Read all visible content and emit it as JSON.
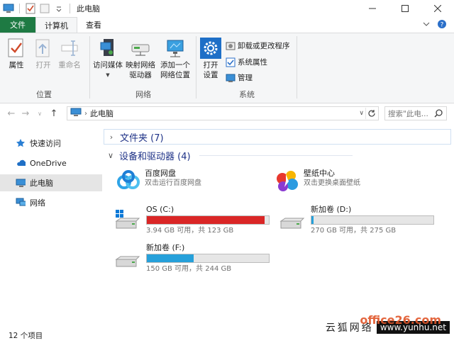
{
  "window": {
    "title": "此电脑",
    "controls": [
      "minimize",
      "maximize",
      "close"
    ]
  },
  "ribbon": {
    "tabs": [
      {
        "label": "文件",
        "active": false
      },
      {
        "label": "计算机",
        "active": true
      },
      {
        "label": "查看",
        "active": false
      }
    ],
    "groups": {
      "location": {
        "label": "位置",
        "buttons": [
          {
            "label": "属性",
            "icon": "properties-icon",
            "enabled": true
          },
          {
            "label": "打开",
            "icon": "open-icon",
            "enabled": false
          },
          {
            "label": "重命名",
            "icon": "rename-icon",
            "enabled": false
          }
        ]
      },
      "network": {
        "label": "网络",
        "access_media": {
          "label": "访问媒体",
          "icon": "media-server-icon"
        },
        "map_drive": {
          "line1": "映射网络",
          "line2": "驱动器",
          "icon": "network-drive-icon"
        },
        "add_location": {
          "line1": "添加一个",
          "line2": "网络位置",
          "icon": "monitor-network-icon"
        }
      },
      "system": {
        "label": "系统",
        "open_settings": {
          "line1": "打开",
          "line2": "设置",
          "icon": "gear-icon"
        },
        "uninstall": {
          "label": "卸载或更改程序",
          "icon": "uninstall-icon"
        },
        "sys_props": {
          "label": "系统属性",
          "icon": "system-properties-icon"
        },
        "manage": {
          "label": "管理",
          "icon": "manage-icon"
        }
      }
    }
  },
  "address": {
    "breadcrumb": "此电脑",
    "search_placeholder": "搜索\"此电..."
  },
  "sidebar": {
    "items": [
      {
        "label": "快速访问",
        "icon": "star-icon",
        "selected": false
      },
      {
        "label": "OneDrive",
        "icon": "cloud-icon",
        "selected": false
      },
      {
        "label": "此电脑",
        "icon": "computer-icon",
        "selected": true
      },
      {
        "label": "网络",
        "icon": "network-icon",
        "selected": false
      }
    ]
  },
  "main": {
    "folders_header": "文件夹 (7)",
    "devices_header": "设备和驱动器 (4)",
    "apps": [
      {
        "name": "百度网盘",
        "subtitle": "双击运行百度网盘",
        "icon": "baidu-netdisk-icon"
      },
      {
        "name": "壁纸中心",
        "subtitle": "双击更换桌面壁纸",
        "icon": "wallpaper-center-icon"
      }
    ],
    "drives": [
      {
        "name": "OS (C:)",
        "usage": "3.94 GB 可用，共 123 GB",
        "used_fraction": 0.968,
        "low_space": true,
        "icon": "windows-drive-icon"
      },
      {
        "name": "新加卷 (D:)",
        "usage": "270 GB 可用，共 275 GB",
        "used_fraction": 0.018,
        "low_space": false,
        "icon": "hard-drive-icon"
      },
      {
        "name": "新加卷 (F:)",
        "usage": "150 GB 可用，共 244 GB",
        "used_fraction": 0.385,
        "low_space": false,
        "icon": "hard-drive-icon"
      }
    ]
  },
  "status_bar": {
    "count": "12 个项目"
  },
  "watermark": {
    "chinese": "云狐网络",
    "url": "www.yunhu.net",
    "logo": "office26.com"
  }
}
